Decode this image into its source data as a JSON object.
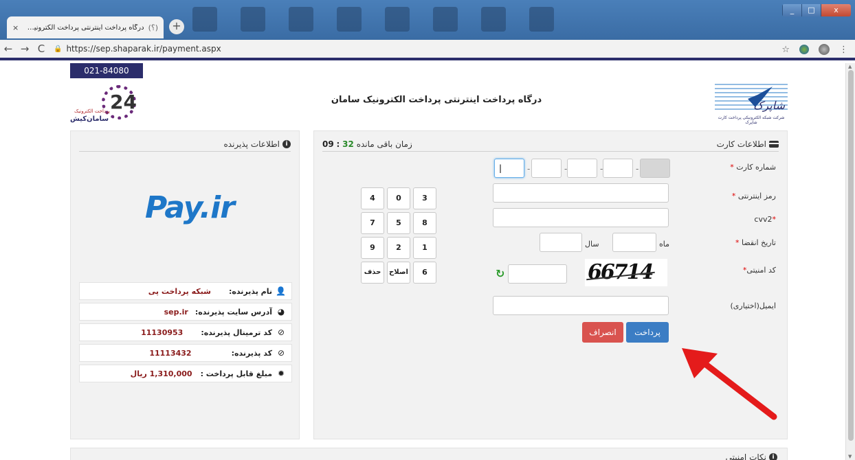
{
  "browser": {
    "tab_title": "درگاه پرداخت اینترنتی پرداخت الکترونیک س...",
    "tab_close": "×",
    "tab_favicon": "(؟)",
    "newtab": "+",
    "win_min": "_",
    "win_max": "□",
    "win_close": "x",
    "back": "←",
    "forward": "→",
    "reload": "C",
    "url": "https://sep.shaparak.ir/payment.aspx",
    "star": "☆",
    "menu": "⋮"
  },
  "header": {
    "phone": "021-84080",
    "gateway_title": "درگاه پرداخت اینترنتی پرداخت الکترونیک سامان",
    "left_logo_number": "24",
    "left_logo_caption": "پرداخت الکترونیک",
    "left_logo_name": "سامان‌کیش",
    "right_logo_script": "شاپرک",
    "right_logo_caption": "شرکت شبکه الکترونیکی پرداخت کارت شاپرک"
  },
  "merchant": {
    "title": "اطلاعات پذیرنده",
    "brand": "Pay.ir",
    "rows": [
      {
        "label": "نام پذیرنده:",
        "value": "شبکه پرداخت پی",
        "icon": "user-icon",
        "glyph": "👤"
      },
      {
        "label": "آدرس سایت پذیرنده:",
        "value": "sep.ir",
        "icon": "globe-icon",
        "glyph": "◕"
      },
      {
        "label": "کد ترمینال پذیرنده:",
        "value": "11130953",
        "icon": "check-circle-icon",
        "glyph": "⊘"
      },
      {
        "label": "کد پذیرنده:",
        "value": "11113432",
        "icon": "check-circle-icon",
        "glyph": "⊘"
      },
      {
        "label": "مبلغ قابل پرداخت :",
        "value": "1,310,000 ریال",
        "icon": "badge-icon",
        "glyph": "✹"
      }
    ]
  },
  "card": {
    "title": "اطلاعات کارت",
    "timer_label": "زمان باقی مانده",
    "timer_min": "32",
    "timer_sep": ":",
    "timer_sec": "09",
    "card_number_label": "شماره کارت",
    "card_number_first": "|",
    "password_label": "رمز اینترنتی",
    "cvv2_label": "cvv2",
    "expiry_label": "تاریخ انقضا",
    "month_label": "ماه",
    "year_label": "سال",
    "captcha_label": "کد امنیتی",
    "captcha_text": "66714",
    "email_label": "ایمیل(اختیاری)",
    "pay_button": "پرداخت",
    "cancel_button": "انصراف",
    "required_mark": "*"
  },
  "keypad": {
    "keys": [
      "4",
      "0",
      "3",
      "7",
      "5",
      "8",
      "9",
      "2",
      "1",
      "حذف",
      "اصلاح",
      "6"
    ]
  },
  "notes": {
    "title": "نکات امنیتی"
  },
  "colors": {
    "brand_navy": "#2b2d6b",
    "pay_blue": "#3b7dc4",
    "cancel_red": "#d9534f",
    "value_red": "#8a1b1b",
    "arrow_red": "#e41b1b"
  }
}
